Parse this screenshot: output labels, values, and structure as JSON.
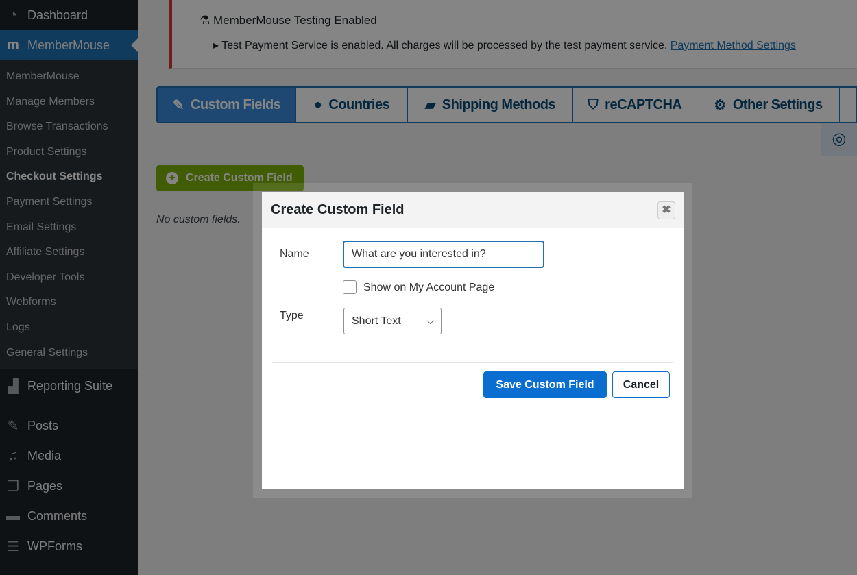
{
  "sidebar": {
    "top": [
      {
        "label": "Dashboard",
        "icon": "dashboard-icon"
      },
      {
        "label": "MemberMouse",
        "icon": "membermouse-icon"
      }
    ],
    "submenu": [
      "MemberMouse",
      "Manage Members",
      "Browse Transactions",
      "Product Settings",
      "Checkout Settings",
      "Payment Settings",
      "Email Settings",
      "Affiliate Settings",
      "Developer Tools",
      "Webforms",
      "Logs",
      "General Settings"
    ],
    "bottom": [
      {
        "label": "Reporting Suite"
      },
      {
        "label": "Posts"
      },
      {
        "label": "Media"
      },
      {
        "label": "Pages"
      },
      {
        "label": "Comments"
      },
      {
        "label": "WPForms"
      }
    ]
  },
  "notice": {
    "title": "MemberMouse Testing Enabled",
    "text": "Test Payment Service is enabled. All charges will be processed by the test payment service.",
    "link": "Payment Method Settings"
  },
  "tabs": [
    {
      "label": "Custom Fields",
      "icon": "edit-icon"
    },
    {
      "label": "Countries",
      "icon": "globe-icon"
    },
    {
      "label": "Shipping Methods",
      "icon": "truck-icon"
    },
    {
      "label": "reCAPTCHA",
      "icon": "shield-icon"
    },
    {
      "label": "Other Settings",
      "icon": "gears-icon"
    }
  ],
  "create_button": "Create Custom Field",
  "empty_text": "No custom fields.",
  "modal": {
    "title": "Create Custom Field",
    "name_label": "Name",
    "name_value": "What are you interested in?",
    "checkbox_label": "Show on My Account Page",
    "type_label": "Type",
    "type_value": "Short Text",
    "save": "Save Custom Field",
    "cancel": "Cancel"
  }
}
